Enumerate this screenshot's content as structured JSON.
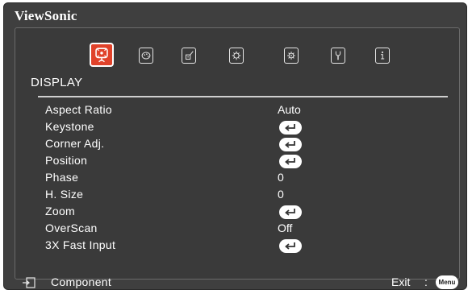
{
  "brand": "ViewSonic",
  "menu_tabs": [
    {
      "name": "display",
      "icon": "display-icon",
      "active": true
    },
    {
      "name": "image",
      "icon": "palette-icon",
      "active": false
    },
    {
      "name": "power",
      "icon": "power-plug-icon",
      "active": false
    },
    {
      "name": "basic",
      "icon": "gear-icon",
      "active": false
    },
    {
      "name": "advanced",
      "icon": "gears-icon",
      "active": false
    },
    {
      "name": "system",
      "icon": "wrench-icon",
      "active": false
    },
    {
      "name": "information",
      "icon": "info-icon",
      "active": false
    }
  ],
  "section_title": "DISPLAY",
  "rows": [
    {
      "label": "Aspect Ratio",
      "value": "Auto"
    },
    {
      "label": "Keystone",
      "value": "",
      "enter": true
    },
    {
      "label": "Corner Adj.",
      "value": "",
      "enter": true
    },
    {
      "label": "Position",
      "value": "",
      "enter": true
    },
    {
      "label": "Phase",
      "value": "0"
    },
    {
      "label": "H. Size",
      "value": "0"
    },
    {
      "label": "Zoom",
      "value": "",
      "enter": true
    },
    {
      "label": "OverScan",
      "value": "Off"
    },
    {
      "label": "3X Fast Input",
      "value": "",
      "enter": true
    }
  ],
  "footer": {
    "source_label": "Component",
    "exit_label": "Exit",
    "colon": ":",
    "menu_button": "Menu"
  },
  "colors": {
    "accent": "#e0422a",
    "background": "#3f3f3f",
    "text": "#ffffff"
  }
}
